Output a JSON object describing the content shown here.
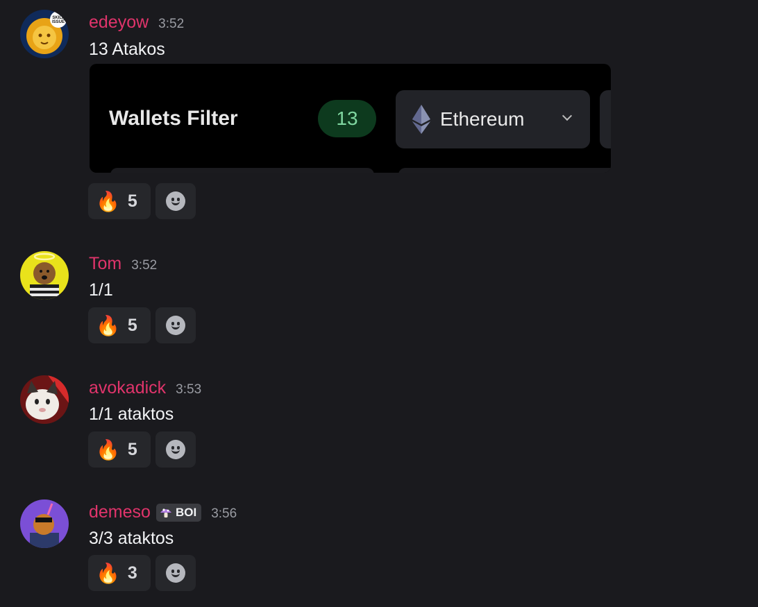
{
  "messages": [
    {
      "username": "edeyow",
      "time": "3:52",
      "text": "13 Atakos",
      "avatar": "lion-avatar",
      "avatar_badge": "SKILL ISSUE",
      "embed": {
        "title": "Wallets Filter",
        "count": "13",
        "network": "Ethereum"
      },
      "reaction_emoji": "🔥",
      "reaction_count": "5"
    },
    {
      "username": "Tom",
      "time": "3:52",
      "text": "1/1",
      "avatar": "angel-avatar",
      "reaction_emoji": "🔥",
      "reaction_count": "5"
    },
    {
      "username": "avokadick",
      "time": "3:53",
      "text": "1/1 ataktos",
      "avatar": "cat-avatar",
      "reaction_emoji": "🔥",
      "reaction_count": "5"
    },
    {
      "username": "demeso",
      "time": "3:56",
      "text": "3/3 ataktos",
      "avatar": "purple-avatar",
      "role_badge": "BOI",
      "reaction_emoji": "🔥",
      "reaction_count": "3"
    }
  ],
  "colors": {
    "background": "#1a1a1e",
    "username": "#e0346b",
    "timestamp": "#9a9ca3",
    "reaction_bg": "#26272b",
    "count_badge_bg": "#0d3a1e",
    "count_badge_text": "#7fd6a0"
  }
}
